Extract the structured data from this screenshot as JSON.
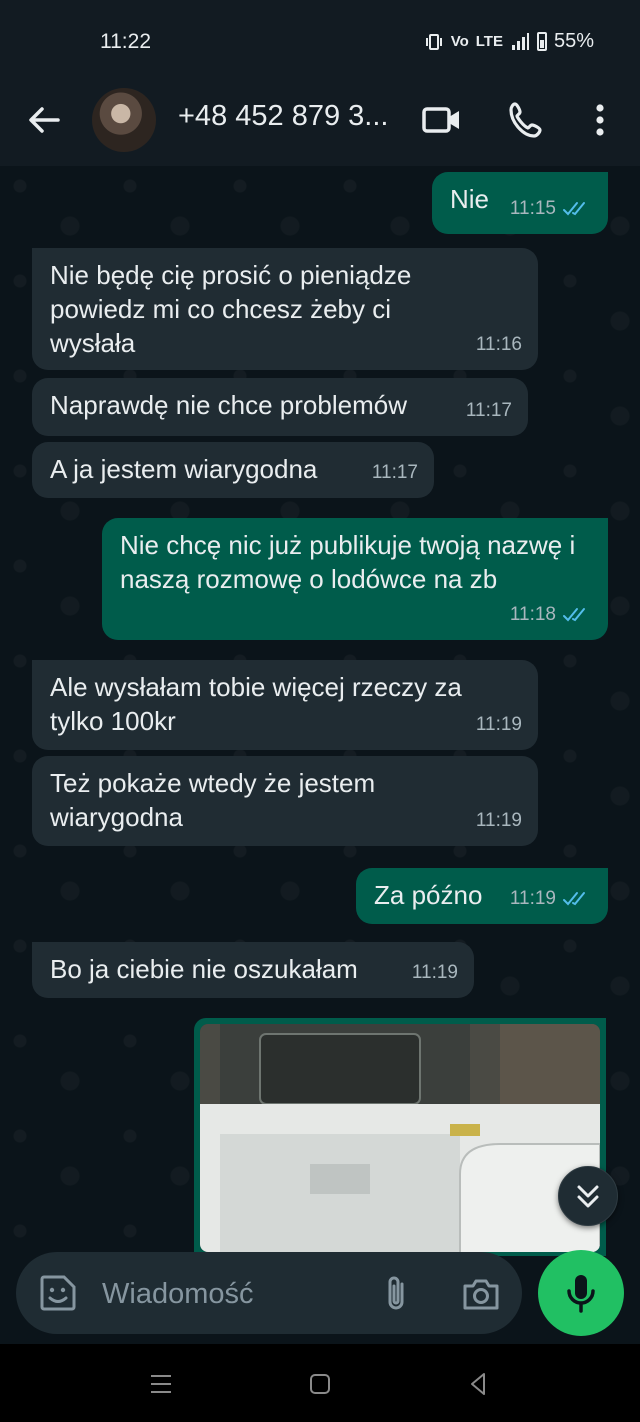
{
  "status_bar": {
    "time": "11:22",
    "network": "LTE",
    "battery": "55%"
  },
  "header": {
    "contact_name": "+48 452 879 3..."
  },
  "messages": [
    {
      "direction": "out",
      "text": "Nie",
      "time": "11:15",
      "read": true
    },
    {
      "direction": "in",
      "text": "Nie będę cię prosić o pieniądze powiedz mi co chcesz żeby ci wysłała",
      "time": "11:16"
    },
    {
      "direction": "in",
      "text": "Naprawdę nie chce problemów",
      "time": "11:17"
    },
    {
      "direction": "in",
      "text": "A ja jestem wiarygodna",
      "time": "11:17"
    },
    {
      "direction": "out",
      "text": "Nie chcę nic już publikuje twoją nazwę i naszą rozmowę o lodówce na zb",
      "time": "11:18",
      "read": true
    },
    {
      "direction": "in",
      "text": "Ale wysłałam tobie więcej rzeczy za tylko 100kr",
      "time": "11:19"
    },
    {
      "direction": "in",
      "text": "Też pokaże wtedy że jestem wiarygodna",
      "time": "11:19"
    },
    {
      "direction": "out",
      "text": "Za późno",
      "time": "11:19",
      "read": true
    },
    {
      "direction": "in",
      "text": "Bo ja ciebie nie oszukałam",
      "time": "11:19"
    }
  ],
  "input": {
    "placeholder": "Wiadomość"
  },
  "colors": {
    "background": "#0b141a",
    "incoming_bubble": "#202c33",
    "outgoing_bubble": "#005c4b",
    "read_ticks": "#53bdeb",
    "mic_button": "#21c063"
  }
}
